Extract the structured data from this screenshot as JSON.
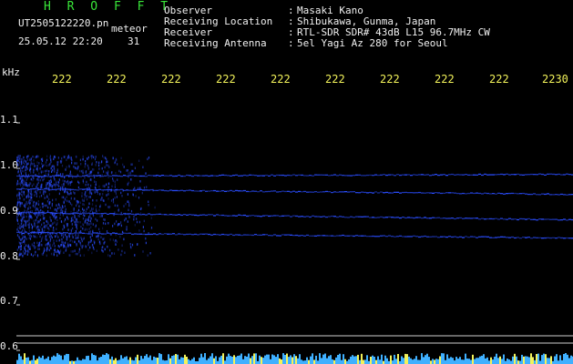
{
  "header": {
    "title": "H R O F F T",
    "filename": "UT2505122220.pn",
    "mode": "meteor",
    "datetime": "25.05.12 22:20",
    "count": "31"
  },
  "meta": [
    {
      "label": "Observer",
      "value": "Masaki Kano"
    },
    {
      "label": "Receiving Location",
      "value": "Shibukawa, Gunma, Japan"
    },
    {
      "label": "Receiver",
      "value": "RTL-SDR SDR# 43dB L15 96.7MHz CW"
    },
    {
      "label": "Receiving Antenna",
      "value": "5el Yagi Az 280 for Seoul"
    }
  ],
  "separator": ":",
  "axis": {
    "unit": "kHz",
    "y_ticks": [
      "1.1",
      "1.0",
      "0.9",
      "0.8",
      "0.7",
      "0.6"
    ],
    "x_ticks": [
      "222",
      "222",
      "222",
      "222",
      "222",
      "222",
      "222",
      "222",
      "222",
      "2230"
    ]
  },
  "colors": {
    "background": "#000000",
    "header_green": "#39e639",
    "label_yellow": "#f2f25a",
    "trace_blue": "#2a4dff",
    "grid_white": "#cfcfcf"
  }
}
